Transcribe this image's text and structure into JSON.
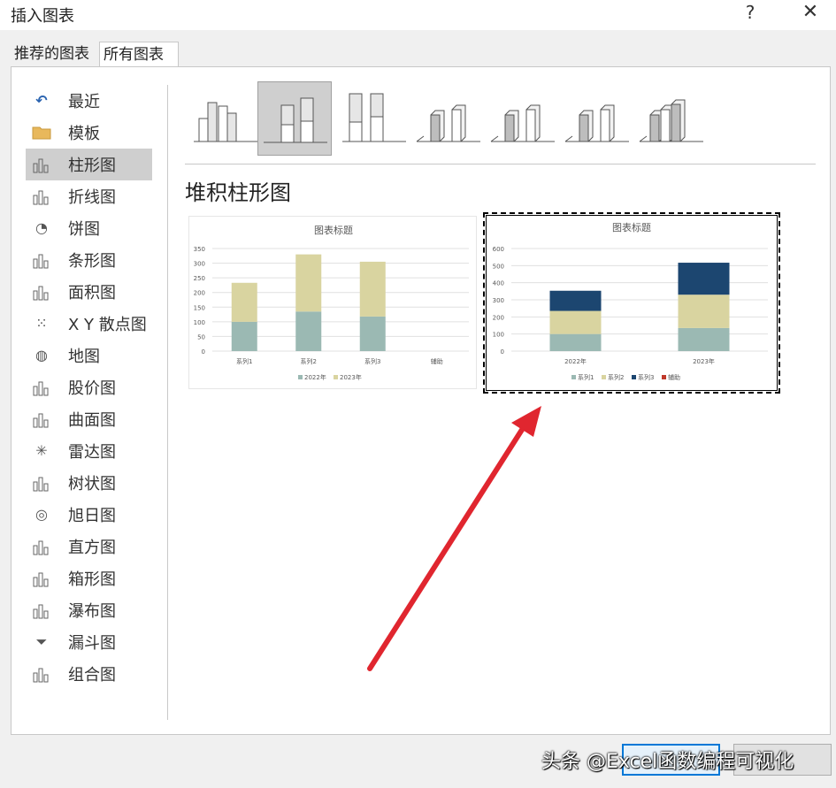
{
  "window": {
    "title": "插入图表",
    "help_glyph": "?",
    "close_glyph": "✕"
  },
  "tabs": [
    {
      "label": "推荐的图表",
      "active": false
    },
    {
      "label": "所有图表",
      "active": true
    }
  ],
  "sidebar": {
    "items": [
      {
        "label": "最近",
        "icon": "recent-icon",
        "glyph": "↶"
      },
      {
        "label": "模板",
        "icon": "folder-icon",
        "glyph": ""
      },
      {
        "label": "柱形图",
        "icon": "column-chart-icon",
        "glyph": "",
        "selected": true
      },
      {
        "label": "折线图",
        "icon": "line-chart-icon",
        "glyph": ""
      },
      {
        "label": "饼图",
        "icon": "pie-chart-icon",
        "glyph": "◔"
      },
      {
        "label": "条形图",
        "icon": "bar-chart-icon",
        "glyph": ""
      },
      {
        "label": "面积图",
        "icon": "area-chart-icon",
        "glyph": ""
      },
      {
        "label": "X Y 散点图",
        "icon": "scatter-chart-icon",
        "glyph": "⁙"
      },
      {
        "label": "地图",
        "icon": "map-chart-icon",
        "glyph": "◍"
      },
      {
        "label": "股价图",
        "icon": "stock-chart-icon",
        "glyph": ""
      },
      {
        "label": "曲面图",
        "icon": "surface-chart-icon",
        "glyph": ""
      },
      {
        "label": "雷达图",
        "icon": "radar-chart-icon",
        "glyph": "✳"
      },
      {
        "label": "树状图",
        "icon": "treemap-chart-icon",
        "glyph": ""
      },
      {
        "label": "旭日图",
        "icon": "sunburst-chart-icon",
        "glyph": "◎"
      },
      {
        "label": "直方图",
        "icon": "histogram-chart-icon",
        "glyph": ""
      },
      {
        "label": "箱形图",
        "icon": "boxplot-chart-icon",
        "glyph": ""
      },
      {
        "label": "瀑布图",
        "icon": "waterfall-chart-icon",
        "glyph": ""
      },
      {
        "label": "漏斗图",
        "icon": "funnel-chart-icon",
        "glyph": "⏷"
      },
      {
        "label": "组合图",
        "icon": "combo-chart-icon",
        "glyph": ""
      }
    ]
  },
  "subtypes": {
    "selected_index": 1,
    "items": [
      "clustered-column-icon",
      "stacked-column-icon",
      "percent-stacked-column-icon",
      "3d-clustered-column-icon",
      "3d-stacked-column-icon",
      "3d-percent-stacked-column-icon",
      "3d-column-icon"
    ]
  },
  "heading": "堆积柱形图",
  "colors": {
    "series1": "#9bb9b3",
    "series2": "#d9d4a0",
    "series3": "#1c4670",
    "aux": "#c0392b",
    "accent_arrow": "#e0262f",
    "gridline": "#e0e0e0",
    "axis_text": "#595959",
    "selection": "#cfcfcf"
  },
  "chart_data": [
    {
      "type": "bar",
      "stacked": true,
      "title": "图表标题",
      "categories": [
        "系列1",
        "系列2",
        "系列3",
        "辅助"
      ],
      "series": [
        {
          "name": "2022年",
          "values": [
            100,
            135,
            118,
            0
          ],
          "color_key": "series1"
        },
        {
          "name": "2023年",
          "values": [
            133,
            195,
            187,
            0
          ],
          "color_key": "series2"
        }
      ],
      "ylim": [
        0,
        350
      ],
      "yticks": [
        0,
        50,
        100,
        150,
        200,
        250,
        300,
        350
      ],
      "grid": true,
      "legend": "bottom",
      "legend_entries": [
        "2022年",
        "2023年"
      ]
    },
    {
      "type": "bar",
      "stacked": true,
      "title": "图表标题",
      "categories": [
        "2022年",
        "2023年"
      ],
      "series": [
        {
          "name": "系列1",
          "values": [
            100,
            135
          ],
          "color_key": "series1"
        },
        {
          "name": "系列2",
          "values": [
            135,
            195
          ],
          "color_key": "series2"
        },
        {
          "name": "系列3",
          "values": [
            118,
            187
          ],
          "color_key": "series3"
        },
        {
          "name": "辅助",
          "values": [
            0,
            0
          ],
          "color_key": "aux"
        }
      ],
      "ylim": [
        0,
        600
      ],
      "yticks": [
        0,
        100,
        200,
        300,
        400,
        500,
        600
      ],
      "grid": true,
      "legend": "bottom",
      "legend_entries": [
        "系列1",
        "系列2",
        "系列3",
        "辅助"
      ]
    }
  ],
  "buttons": {
    "ok": "",
    "cancel": ""
  },
  "watermark": "头条 @Excel函数编程可视化"
}
